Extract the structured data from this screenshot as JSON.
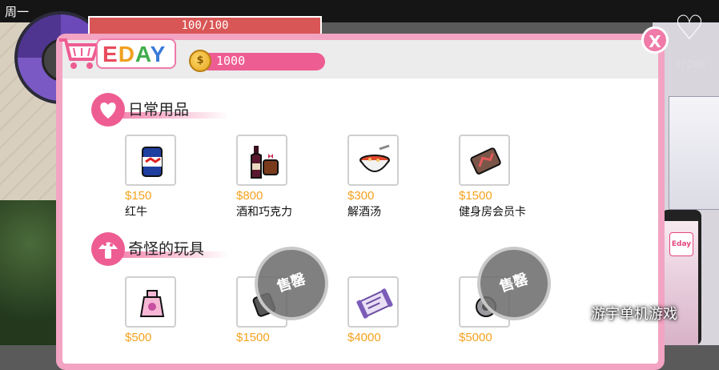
{
  "hud": {
    "day": "周一",
    "hp": "100/100",
    "right_counter": "0/200"
  },
  "shop": {
    "logo": "EDAY",
    "coins": "1000",
    "close": "X",
    "categories": [
      {
        "label": "日常用品",
        "items": [
          {
            "price": "$150",
            "name": "红牛",
            "icon": "canned-drink-icon"
          },
          {
            "price": "$800",
            "name": "酒和巧克力",
            "icon": "wine-chocolate-icon"
          },
          {
            "price": "$300",
            "name": "解酒汤",
            "icon": "soup-bowl-icon"
          },
          {
            "price": "$1500",
            "name": "健身房会员卡",
            "icon": "membership-card-icon"
          }
        ]
      },
      {
        "label": "奇怪的玩具",
        "items": [
          {
            "price": "$500",
            "name": "",
            "icon": "toy-icon"
          },
          {
            "price": "$1500",
            "name": "",
            "icon": "toy-icon",
            "sold_out": "售罄"
          },
          {
            "price": "$4000",
            "name": "",
            "icon": "scroll-icon"
          },
          {
            "price": "$5000",
            "name": "",
            "icon": "toy-icon",
            "sold_out": "售罄"
          }
        ]
      }
    ]
  },
  "watermark": "游宇单机游戏",
  "phone_app": "Eday",
  "colors": {
    "panel_border": "#f3a4c2",
    "accent_pink": "#ee5d92",
    "price": "#f4a21f",
    "hp_bar": "#d95656"
  }
}
